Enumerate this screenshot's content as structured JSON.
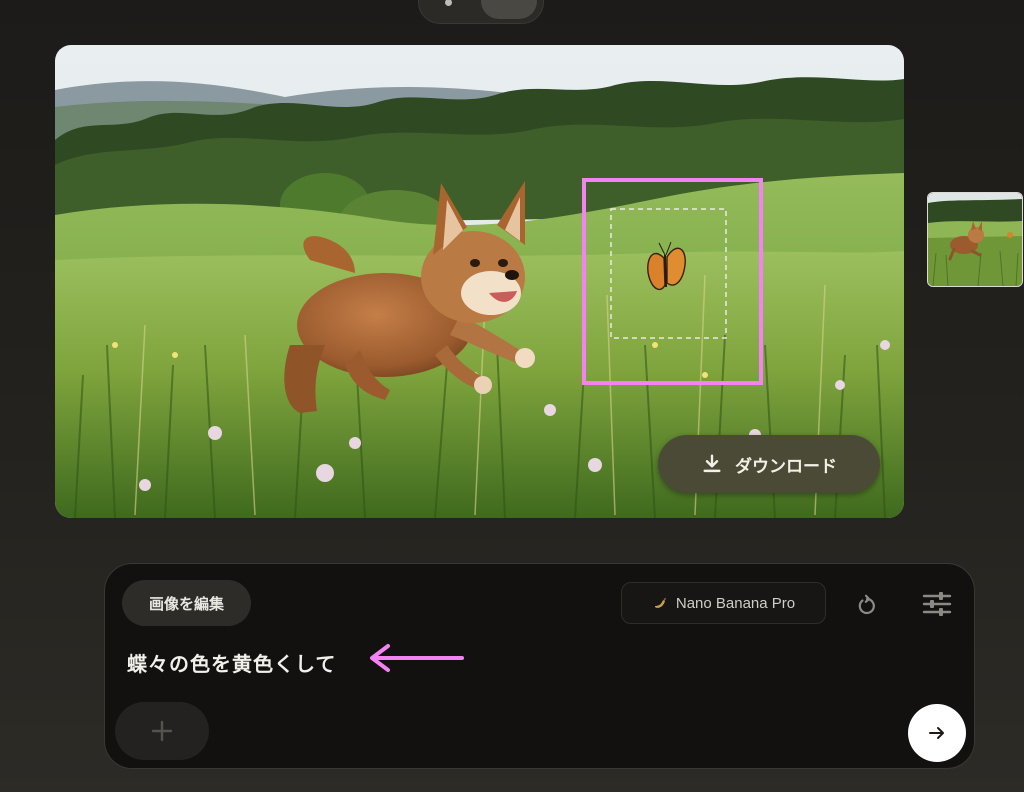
{
  "top_toggle": {
    "options": [
      "dot-icon",
      "waveform-icon"
    ],
    "active": "waveform-icon"
  },
  "image": {
    "download_label": "ダウンロード",
    "download_icon": "download-icon"
  },
  "annotation_color": "#f383f3",
  "thumbnail": {
    "selected": true
  },
  "prompt": {
    "mode_chip": "画像を編集",
    "model_name": "Nano Banana Pro",
    "model_icon": "banana-icon",
    "text": "蝶々の色を黄色くして",
    "add_icon": "plus-icon",
    "send_icon": "arrow-right-icon",
    "refresh_icon": "refresh-icon",
    "settings_icon": "sliders-icon"
  },
  "colors": {
    "download_bg": "#4b4a37",
    "card_bg": "#121110",
    "chip_bg": "#2d2c29"
  }
}
